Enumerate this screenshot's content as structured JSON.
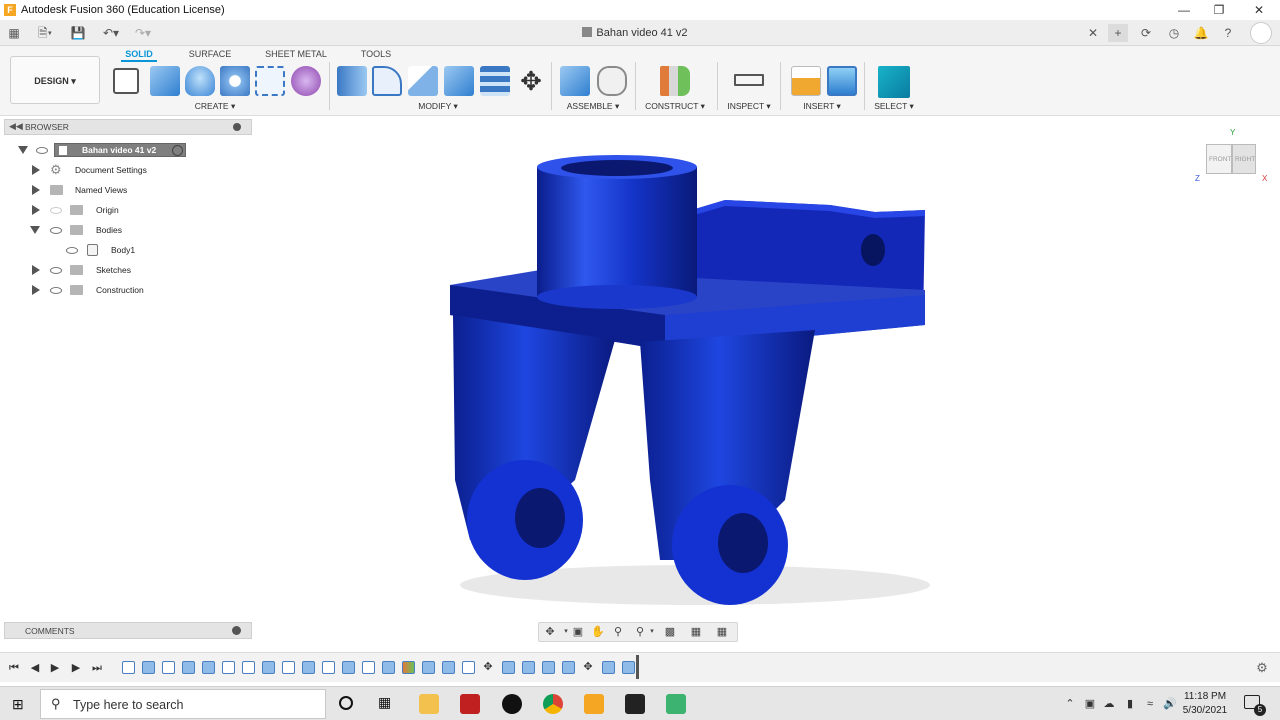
{
  "window": {
    "title": "Autodesk Fusion 360 (Education License)",
    "document_tab": "Bahan video 41 v2"
  },
  "ribbon": {
    "tabs": [
      "SOLID",
      "SURFACE",
      "SHEET METAL",
      "TOOLS"
    ],
    "workspace_button": "DESIGN ▾",
    "groups": [
      "CREATE ▾",
      "MODIFY ▾",
      "ASSEMBLE ▾",
      "CONSTRUCT ▾",
      "INSPECT ▾",
      "INSERT ▾",
      "SELECT ▾"
    ]
  },
  "browser": {
    "title": "BROWSER",
    "items": [
      {
        "label": "Bahan video 41 v2"
      },
      {
        "label": "Document Settings"
      },
      {
        "label": "Named Views"
      },
      {
        "label": "Origin"
      },
      {
        "label": "Bodies"
      },
      {
        "label": "Body1"
      },
      {
        "label": "Sketches"
      },
      {
        "label": "Construction"
      }
    ]
  },
  "comments": {
    "title": "COMMENTS"
  },
  "viewcube": {
    "front": "FRONT",
    "right": "RIGHT",
    "x": "X",
    "y": "Y",
    "z": "Z"
  },
  "taskbar": {
    "search_placeholder": "Type here to search",
    "time": "11:18 PM",
    "date": "5/30/2021",
    "notification_count": "5"
  },
  "colors": {
    "accent": "#0696d7",
    "body_blue": "#1232c8"
  }
}
